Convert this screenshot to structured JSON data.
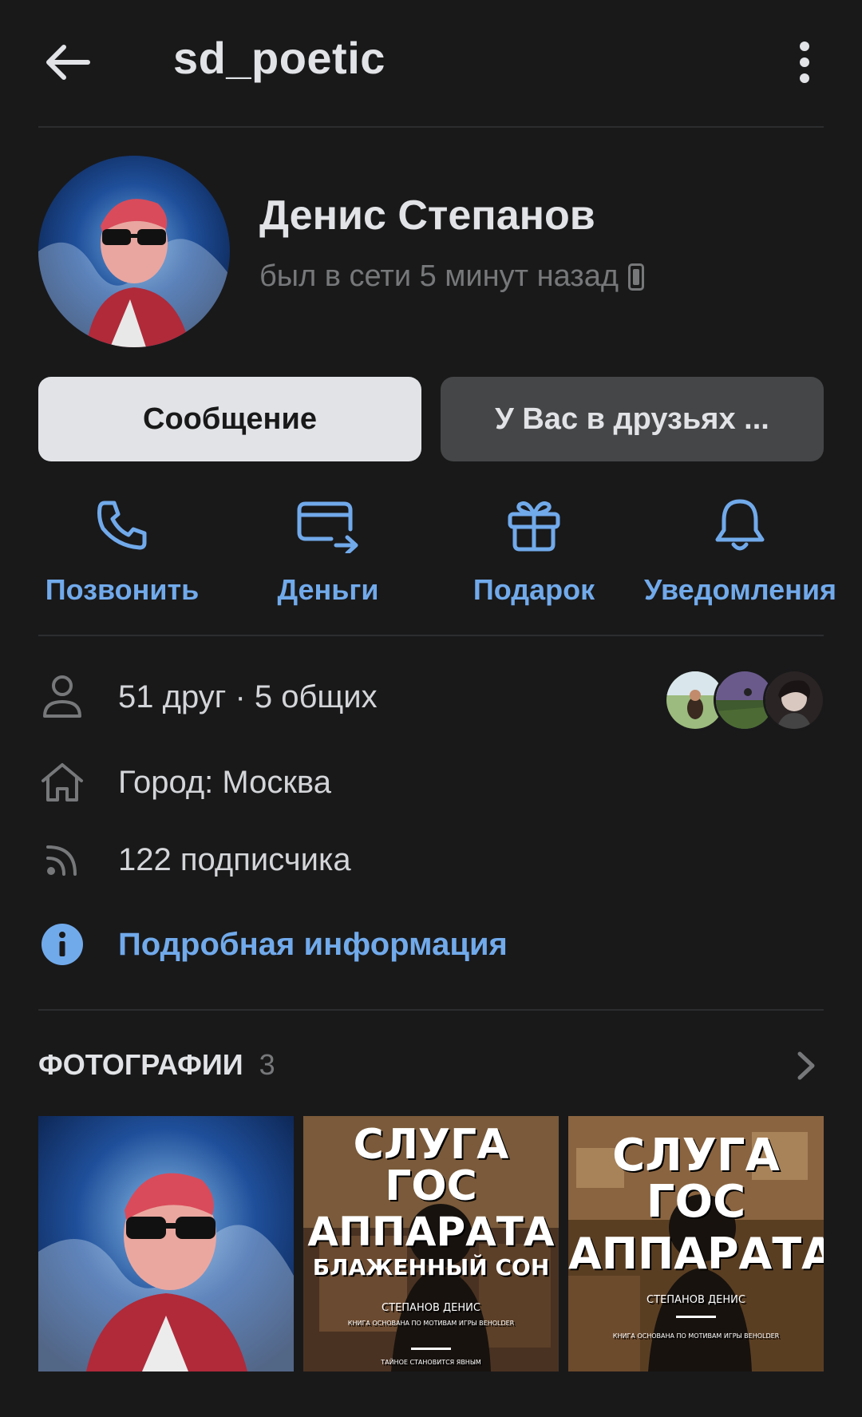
{
  "header": {
    "title": "sd_poetic"
  },
  "profile": {
    "name": "Денис Степанов",
    "status": "был в сети 5 минут назад"
  },
  "buttons": {
    "message": "Сообщение",
    "friend": "У Вас в друзьях ..."
  },
  "actions": [
    {
      "label": "Позвонить",
      "icon": "phone-icon"
    },
    {
      "label": "Деньги",
      "icon": "money-transfer-icon"
    },
    {
      "label": "Подарок",
      "icon": "gift-icon"
    },
    {
      "label": "Уведомления",
      "icon": "bell-icon"
    }
  ],
  "info": {
    "friends": "51 друг · 5 общих",
    "city": "Город: Москва",
    "followers": "122 подписчика",
    "details": "Подробная информация"
  },
  "photos": {
    "title": "ФОТОГРАФИИ",
    "count": "3",
    "covers": [
      {
        "l1": "СЛУГА",
        "l2": "ГОС",
        "l3": "АППАРАТА",
        "l4": "БЛАЖЕННЫЙ СОН",
        "author": "СТЕПАНОВ ДЕНИС",
        "note": "КНИГА ОСНОВАНА ПО МОТИВАМ ИГРЫ BEHOLDER",
        "tagline": "ТАЙНОЕ СТАНОВИТСЯ ЯВНЫМ"
      },
      {
        "l1": "СЛУГА",
        "l2": "ГОС",
        "l3": "АППАРАТА",
        "author": "СТЕПАНОВ ДЕНИС",
        "note": "КНИГА ОСНОВАНА ПО МОТИВАМ ИГРЫ BEHOLDER"
      }
    ]
  },
  "colors": {
    "background": "#19191a",
    "accent": "#71aaeb",
    "primary_button": "#e1e3e6",
    "secondary_button": "#454647",
    "muted": "#76787a"
  }
}
